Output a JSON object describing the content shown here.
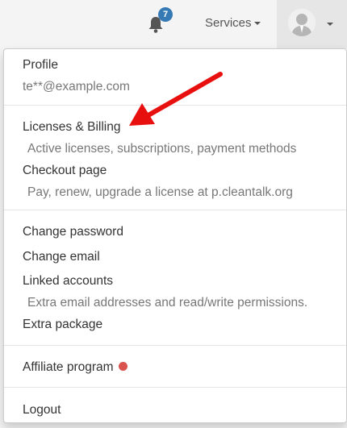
{
  "navbar": {
    "notification_count": "7",
    "services_label": "Services"
  },
  "menu": {
    "profile_label": "Profile",
    "email": "te**@example.com",
    "licenses_label": "Licenses & Billing",
    "licenses_desc": "Active licenses, subscriptions, payment methods",
    "checkout_label": "Checkout page",
    "checkout_desc": "Pay, renew, upgrade a license at p.cleantalk.org",
    "change_password_label": "Change password",
    "change_email_label": "Change email",
    "linked_accounts_label": "Linked accounts",
    "linked_accounts_desc": "Extra email addresses and read/write permissions.",
    "extra_package_label": "Extra package",
    "affiliate_label": "Affiliate program",
    "logout_label": "Logout"
  },
  "colors": {
    "badge": "#3579b5",
    "affiliate_dot": "#d9534f",
    "annotation_arrow": "#e8100f"
  },
  "icons": [
    "bell-icon",
    "avatar-icon",
    "caret-down-icon",
    "annotation-arrow"
  ]
}
